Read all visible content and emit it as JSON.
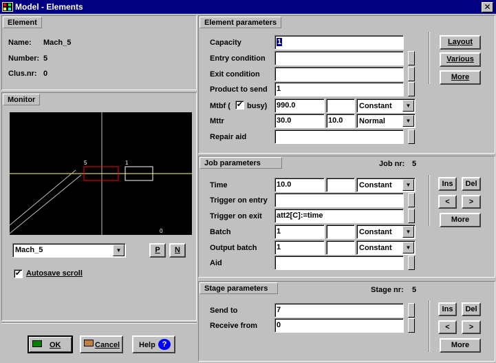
{
  "window": {
    "title": "Model - Elements"
  },
  "element": {
    "heading": "Element",
    "name_label": "Name:",
    "name_value": "Mach_5",
    "number_label": "Number:",
    "number_value": "5",
    "clus_label": "Clus.nr:",
    "clus_value": "0"
  },
  "monitor": {
    "heading": "Monitor",
    "markers": {
      "left": "5",
      "right": "1",
      "bottom": "0"
    },
    "select_value": "Mach_5",
    "prev_label": "P",
    "next_label": "N",
    "autosave_label": "Autosave scroll",
    "autosave_checked": true
  },
  "footer": {
    "ok_label": "OK",
    "cancel_label": "Cancel",
    "help_label": "Help"
  },
  "element_params": {
    "heading": "Element parameters",
    "capacity_label": "Capacity",
    "capacity_value": "1",
    "entry_label": "Entry condition",
    "entry_value": "",
    "exit_label": "Exit condition",
    "exit_value": "",
    "product_label": "Product to send",
    "product_value": "1",
    "mtbf_label": "Mtbf (",
    "busy_label": "busy)",
    "busy_checked": true,
    "mtbf_value": "990.0",
    "mtbf_value2": "",
    "mtbf_dist": "Constant",
    "mttr_label": "Mttr",
    "mttr_value": "30.0",
    "mttr_value2": "10.0",
    "mttr_dist": "Normal",
    "repair_label": "Repair aid",
    "repair_value": "",
    "layout_label": "Layout",
    "various_label": "Various",
    "more_label": "More"
  },
  "job_params": {
    "heading": "Job parameters",
    "job_nr_label": "Job nr:",
    "job_nr_value": "5",
    "time_label": "Time",
    "time_value": "10.0",
    "time_value2": "",
    "time_dist": "Constant",
    "trig_entry_label": "Trigger on entry",
    "trig_entry_value": "",
    "trig_exit_label": "Trigger on exit",
    "trig_exit_value": "att2[C]:=time",
    "batch_label": "Batch",
    "batch_value": "1",
    "batch_value2": "",
    "batch_dist": "Constant",
    "out_batch_label": "Output batch",
    "out_batch_value": "1",
    "out_batch_value2": "",
    "out_batch_dist": "Constant",
    "aid_label": "Aid",
    "aid_value": "",
    "ins_label": "Ins",
    "del_label": "Del",
    "prev_label": "<",
    "next_label": ">",
    "more_label": "More"
  },
  "stage_params": {
    "heading": "Stage parameters",
    "stage_nr_label": "Stage nr:",
    "stage_nr_value": "5",
    "send_label": "Send to",
    "send_value": "7",
    "receive_label": "Receive from",
    "receive_value": "0",
    "ins_label": "Ins",
    "del_label": "Del",
    "prev_label": "<",
    "next_label": ">",
    "more_label": "More"
  },
  "colors": {
    "titlebar": "#000080",
    "monitor_bg": "#000000",
    "monitor_axis": "#ffff80",
    "red_box": "#ff0000",
    "help_icon": "#0000ff",
    "ok_flag": "#008000"
  }
}
